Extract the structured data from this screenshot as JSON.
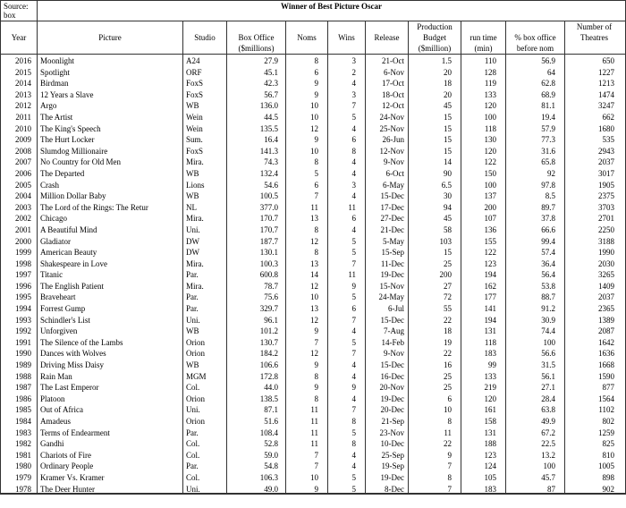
{
  "source_label": "Source:",
  "source_value": "box",
  "title": "Winner of Best Picture Oscar",
  "headers_row1": {
    "year": "",
    "picture": "",
    "studio": "",
    "box": "",
    "noms": "",
    "wins": "",
    "release": "",
    "budget": "Production",
    "runtime": "",
    "pct": "",
    "theatres": "Number of"
  },
  "headers_row2": {
    "year": "Year",
    "picture": "Picture",
    "studio": "Studio",
    "box": "Box Office",
    "noms": "Noms",
    "wins": "Wins",
    "release": "Release",
    "budget": "Budget",
    "runtime": "run time",
    "pct": "% box office",
    "theatres": "Theatres"
  },
  "headers_row3": {
    "year": "",
    "picture": "",
    "studio": "",
    "box": "($millions)",
    "noms": "",
    "wins": "",
    "release": "",
    "budget": "($million)",
    "runtime": "(min)",
    "pct": "before nom",
    "theatres": ""
  },
  "chart_data": {
    "type": "table",
    "columns": [
      "Year",
      "Picture",
      "Studio",
      "Box Office ($millions)",
      "Noms",
      "Wins",
      "Release",
      "Production Budget ($million)",
      "run time (min)",
      "% box office before nom",
      "Number of Theatres"
    ],
    "rows": [
      [
        "2016",
        "Moonlight",
        "A24",
        "27.9",
        "8",
        "3",
        "21-Oct",
        "1.5",
        "110",
        "56.9",
        "650"
      ],
      [
        "2015",
        "Spotlight",
        "ORF",
        "45.1",
        "6",
        "2",
        "6-Nov",
        "20",
        "128",
        "64",
        "1227"
      ],
      [
        "2014",
        "Birdman",
        "FoxS",
        "42.3",
        "9",
        "4",
        "17-Oct",
        "18",
        "119",
        "62.8",
        "1213"
      ],
      [
        "2013",
        "12 Years a Slave",
        "FoxS",
        "56.7",
        "9",
        "3",
        "18-Oct",
        "20",
        "133",
        "68.9",
        "1474"
      ],
      [
        "2012",
        "Argo",
        "WB",
        "136.0",
        "10",
        "7",
        "12-Oct",
        "45",
        "120",
        "81.1",
        "3247"
      ],
      [
        "2011",
        "The Artist",
        "Wein",
        "44.5",
        "10",
        "5",
        "24-Nov",
        "15",
        "100",
        "19.4",
        "662"
      ],
      [
        "2010",
        "The King's Speech",
        "Wein",
        "135.5",
        "12",
        "4",
        "25-Nov",
        "15",
        "118",
        "57.9",
        "1680"
      ],
      [
        "2009",
        "The Hurt Locker",
        "Sum.",
        "16.4",
        "9",
        "6",
        "26-Jun",
        "15",
        "130",
        "77.3",
        "535"
      ],
      [
        "2008",
        "Slumdog Millionaire",
        "FoxS",
        "141.3",
        "10",
        "8",
        "12-Nov",
        "15",
        "120",
        "31.6",
        "2943"
      ],
      [
        "2007",
        "No Country for Old Men",
        "Mira.",
        "74.3",
        "8",
        "4",
        "9-Nov",
        "14",
        "122",
        "65.8",
        "2037"
      ],
      [
        "2006",
        "The Departed",
        "WB",
        "132.4",
        "5",
        "4",
        "6-Oct",
        "90",
        "150",
        "92",
        "3017"
      ],
      [
        "2005",
        "Crash",
        "Lions",
        "54.6",
        "6",
        "3",
        "6-May",
        "6.5",
        "100",
        "97.8",
        "1905"
      ],
      [
        "2004",
        "Million Dollar Baby",
        "WB",
        "100.5",
        "7",
        "4",
        "15-Dec",
        "30",
        "137",
        "8.5",
        "2375"
      ],
      [
        "2003",
        "The Lord of the Rings: The Retur",
        "NL",
        "377.0",
        "11",
        "11",
        "17-Dec",
        "94",
        "200",
        "89.7",
        "3703"
      ],
      [
        "2002",
        "Chicago",
        "Mira.",
        "170.7",
        "13",
        "6",
        "27-Dec",
        "45",
        "107",
        "37.8",
        "2701"
      ],
      [
        "2001",
        "A Beautiful Mind",
        "Uni.",
        "170.7",
        "8",
        "4",
        "21-Dec",
        "58",
        "136",
        "66.6",
        "2250"
      ],
      [
        "2000",
        "Gladiator",
        "DW",
        "187.7",
        "12",
        "5",
        "5-May",
        "103",
        "155",
        "99.4",
        "3188"
      ],
      [
        "1999",
        "American Beauty",
        "DW",
        "130.1",
        "8",
        "5",
        "15-Sep",
        "15",
        "122",
        "57.4",
        "1990"
      ],
      [
        "1998",
        "Shakespeare in Love",
        "Mira.",
        "100.3",
        "13",
        "7",
        "11-Dec",
        "25",
        "123",
        "36.4",
        "2030"
      ],
      [
        "1997",
        "Titanic",
        "Par.",
        "600.8",
        "14",
        "11",
        "19-Dec",
        "200",
        "194",
        "56.4",
        "3265"
      ],
      [
        "1996",
        "The English Patient",
        "Mira.",
        "78.7",
        "12",
        "9",
        "15-Nov",
        "27",
        "162",
        "53.8",
        "1409"
      ],
      [
        "1995",
        "Braveheart",
        "Par.",
        "75.6",
        "10",
        "5",
        "24-May",
        "72",
        "177",
        "88.7",
        "2037"
      ],
      [
        "1994",
        "Forrest Gump",
        "Par.",
        "329.7",
        "13",
        "6",
        "6-Jul",
        "55",
        "141",
        "91.2",
        "2365"
      ],
      [
        "1993",
        "Schindler's List",
        "Uni.",
        "96.1",
        "12",
        "7",
        "15-Dec",
        "22",
        "194",
        "30.9",
        "1389"
      ],
      [
        "1992",
        "Unforgiven",
        "WB",
        "101.2",
        "9",
        "4",
        "7-Aug",
        "18",
        "131",
        "74.4",
        "2087"
      ],
      [
        "1991",
        "The Silence of the Lambs",
        "Orion",
        "130.7",
        "7",
        "5",
        "14-Feb",
        "19",
        "118",
        "100",
        "1642"
      ],
      [
        "1990",
        "Dances with Wolves",
        "Orion",
        "184.2",
        "12",
        "7",
        "9-Nov",
        "22",
        "183",
        "56.6",
        "1636"
      ],
      [
        "1989",
        "Driving Miss Daisy",
        "WB",
        "106.6",
        "9",
        "4",
        "15-Dec",
        "16",
        "99",
        "31.5",
        "1668"
      ],
      [
        "1988",
        "Rain Man",
        "MGM",
        "172.8",
        "8",
        "4",
        "16-Dec",
        "25",
        "133",
        "56.1",
        "1590"
      ],
      [
        "1987",
        "The Last Emperor",
        "Col.",
        "44.0",
        "9",
        "9",
        "20-Nov",
        "25",
        "219",
        "27.1",
        "877"
      ],
      [
        "1986",
        "Platoon",
        "Orion",
        "138.5",
        "8",
        "4",
        "19-Dec",
        "6",
        "120",
        "28.4",
        "1564"
      ],
      [
        "1985",
        "Out of Africa",
        "Uni.",
        "87.1",
        "11",
        "7",
        "20-Dec",
        "10",
        "161",
        "63.8",
        "1102"
      ],
      [
        "1984",
        "Amadeus",
        "Orion",
        "51.6",
        "11",
        "8",
        "21-Sep",
        "8",
        "158",
        "49.9",
        "802"
      ],
      [
        "1983",
        "Terms of Endearment",
        "Par.",
        "108.4",
        "11",
        "5",
        "23-Nov",
        "11",
        "131",
        "67.2",
        "1259"
      ],
      [
        "1982",
        "Gandhi",
        "Col.",
        "52.8",
        "11",
        "8",
        "10-Dec",
        "22",
        "188",
        "22.5",
        "825"
      ],
      [
        "1981",
        "Chariots of Fire",
        "Col.",
        "59.0",
        "7",
        "4",
        "25-Sep",
        "9",
        "123",
        "13.2",
        "810"
      ],
      [
        "1980",
        "Ordinary People",
        "Par.",
        "54.8",
        "7",
        "4",
        "19-Sep",
        "7",
        "124",
        "100",
        "1005"
      ],
      [
        "1979",
        "Kramer Vs. Kramer",
        "Col.",
        "106.3",
        "10",
        "5",
        "19-Dec",
        "8",
        "105",
        "45.7",
        "898"
      ],
      [
        "1978",
        "The Deer Hunter",
        "Uni.",
        "49.0",
        "9",
        "5",
        "8-Dec",
        "7",
        "183",
        "87",
        "902"
      ]
    ]
  }
}
